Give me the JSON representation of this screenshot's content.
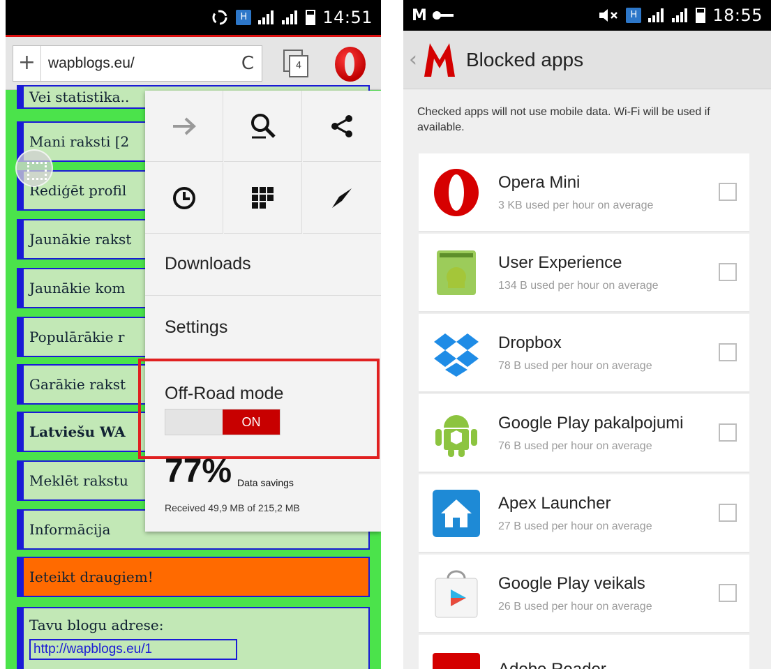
{
  "left": {
    "status": {
      "time": "14:51",
      "network_badge": "H",
      "sim2": "2"
    },
    "toolbar": {
      "url": "wapblogs.eu/",
      "plus": "+",
      "reload": "C",
      "tab_count": "4"
    },
    "page_items": [
      "Vei statistika..",
      "Mani raksti [2",
      "Rediģēt profil",
      "Jaunākie rakst",
      "Jaunākie kom",
      "Populārākie r",
      "Garākie rakst",
      "Latviešu WA",
      "Meklēt rakstu",
      "Informācija",
      "Ieteikt draugiem!",
      "Tavu blogu adrese:"
    ],
    "page_link": "http://wapblogs.eu/1",
    "menu": {
      "downloads": "Downloads",
      "settings": "Settings",
      "offroad_label": "Off-Road mode",
      "toggle_state": "ON",
      "savings_percent": "77%",
      "savings_label": "Data savings",
      "received": "Received 49,9 MB of 215,2 MB"
    }
  },
  "right": {
    "status": {
      "time": "18:55"
    },
    "title": "Blocked apps",
    "description": "Checked apps will not use mobile data. Wi-Fi will be used if available.",
    "apps": [
      {
        "name": "Opera Mini",
        "usage": "3 KB used per hour on average",
        "icon": "opera-icon",
        "checked": false
      },
      {
        "name": "User Experience",
        "usage": "134 B used per hour on average",
        "icon": "android-app-icon",
        "checked": false
      },
      {
        "name": "Dropbox",
        "usage": "78 B used per hour on average",
        "icon": "dropbox-icon",
        "checked": false
      },
      {
        "name": "Google Play pakalpojumi",
        "usage": "76 B used per hour on average",
        "icon": "google-play-services-icon",
        "checked": false
      },
      {
        "name": "Apex Launcher",
        "usage": "27 B used per hour on average",
        "icon": "apex-launcher-icon",
        "checked": false
      },
      {
        "name": "Google Play veikals",
        "usage": "26 B used per hour on average",
        "icon": "google-play-store-icon",
        "checked": false
      },
      {
        "name": "Adobe Reader",
        "usage": "",
        "icon": "adobe-reader-icon",
        "checked": false
      }
    ]
  },
  "colors": {
    "opera_red": "#c80000",
    "page_green": "#4be34b",
    "item_bg": "#c2e8b6",
    "item_border": "#1a1ad6",
    "highlight": "#e02020"
  }
}
